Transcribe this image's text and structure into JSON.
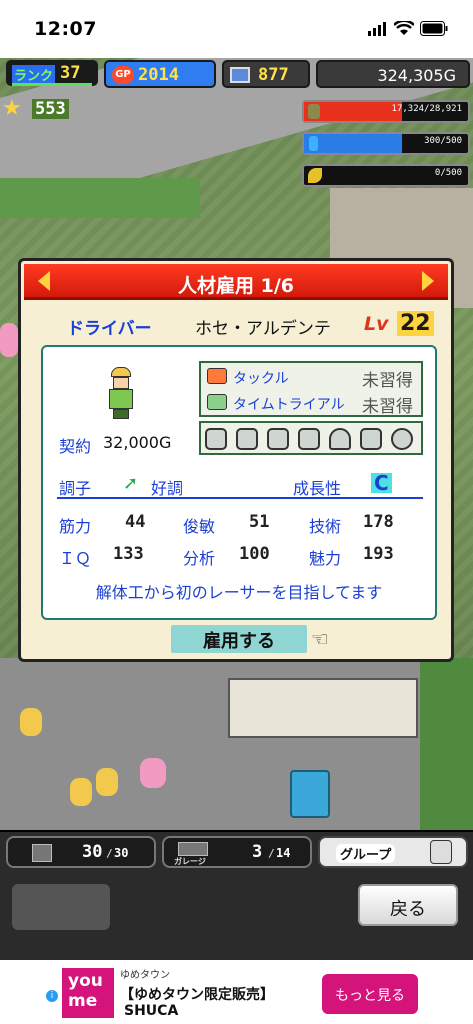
{
  "status_bar": {
    "time": "12:07"
  },
  "hud": {
    "rank_label": "ランク",
    "rank_value": "37",
    "gp_badge": "GP",
    "gp_value": "2014",
    "pc_value": "877",
    "money": "324,305G",
    "stars": "553",
    "resources": [
      {
        "icon": "cylinder-icon",
        "text": "17,324/28,921",
        "fill": 0.599,
        "color": "#e8301c"
      },
      {
        "icon": "bottle-icon",
        "text": "300/500",
        "fill": 0.6,
        "color": "#2a7de6"
      },
      {
        "icon": "leaf-icon",
        "text": "0/500",
        "fill": 0.0,
        "color": "#e6c12a"
      }
    ]
  },
  "dialog": {
    "title": "人材雇用 1/6",
    "job": "ドライバー",
    "name": "ホセ・アルデンテ",
    "level_label": "Lv",
    "level": "22",
    "contract_label": "契約",
    "contract_value": "32,000G",
    "skills": [
      {
        "name": "タックル",
        "status": "未習得",
        "icon": "car-icon"
      },
      {
        "name": "タイムトライアル",
        "status": "未習得",
        "icon": "timer-icon"
      }
    ],
    "parts_icons": [
      "tire-icon",
      "wheel-icon",
      "engine-icon",
      "seat-icon",
      "helmet-icon",
      "wrench-icon",
      "gauge-icon"
    ],
    "condition_label": "調子",
    "condition_value": "好調",
    "growth_label": "成長性",
    "growth_value": "C",
    "stats": [
      {
        "label": "筋力",
        "value": "44"
      },
      {
        "label": "俊敏",
        "value": "51"
      },
      {
        "label": "技術",
        "value": "178"
      },
      {
        "label": "ＩＱ",
        "value": "133"
      },
      {
        "label": "分析",
        "value": "100"
      },
      {
        "label": "魅力",
        "value": "193"
      }
    ],
    "comment": "解体工から初のレーサーを目指してます",
    "hire_button": "雇用する"
  },
  "bottom": {
    "tab1_value": "30",
    "tab1_max": "30",
    "tab2_label": "ガレージ",
    "tab2_value": "3",
    "tab2_max": "14",
    "tab3_label": "グループ",
    "back_button": "戻る"
  },
  "ad": {
    "brand_top": "you",
    "brand_bottom": "me",
    "store": "ゆめタウン",
    "headline": "【ゆめタウン限定販売】",
    "product": "SHUCA",
    "cta": "もっと見る"
  }
}
